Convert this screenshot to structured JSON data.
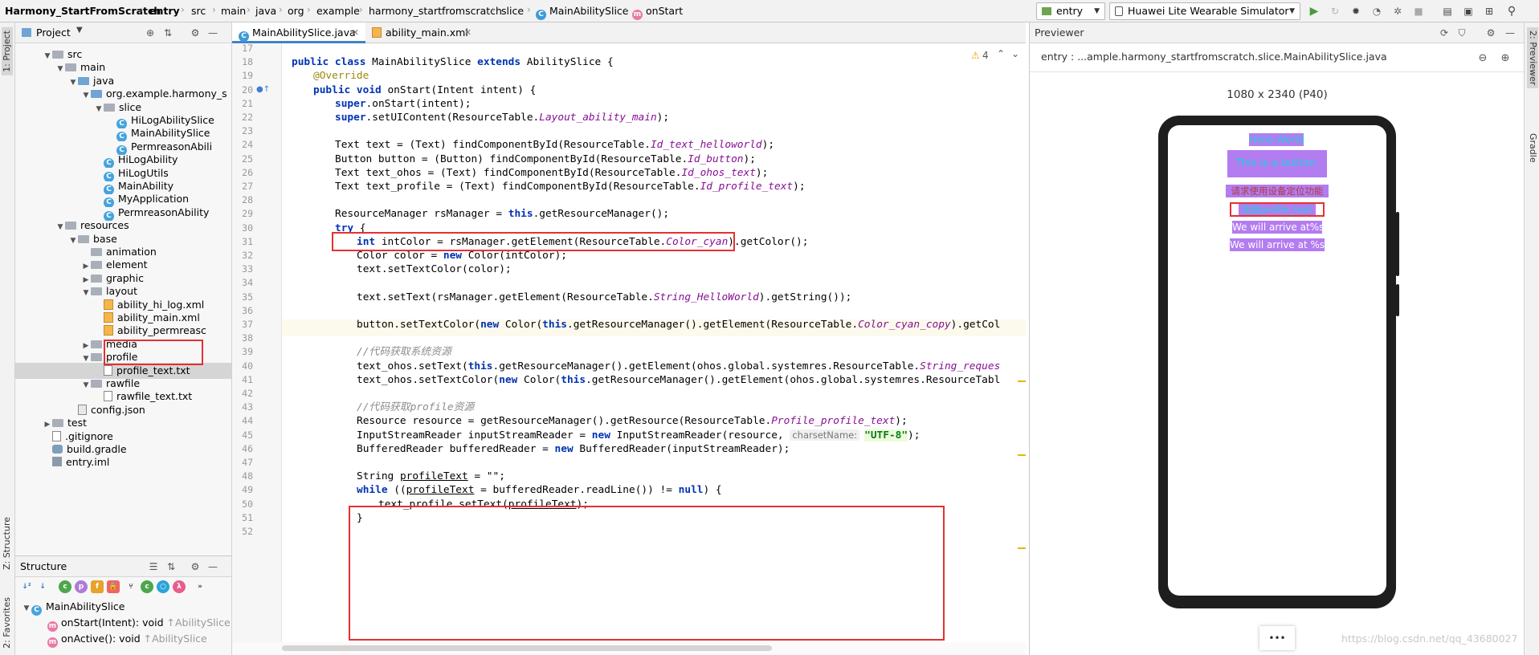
{
  "navbar": {
    "crumbs": [
      "Harmony_StartFromScratch",
      "entry",
      "src",
      "main",
      "java",
      "org",
      "example",
      "harmony_startfromscratch",
      "slice",
      "MainAbilitySlice",
      "onStart"
    ],
    "run_config": "entry",
    "device": "Huawei Lite Wearable Simulator"
  },
  "left_stripe": {
    "project": "1: Project",
    "structure": "Z: Structure",
    "favorites": "2: Favorites"
  },
  "project_panel": {
    "title": "Project",
    "tree": [
      {
        "label": "src",
        "icon": "folder-icon"
      },
      {
        "label": "main",
        "icon": "folder-icon"
      },
      {
        "label": "java",
        "icon": "folder-icon"
      },
      {
        "label": "org.example.harmony_s",
        "icon": "folder-icon"
      },
      {
        "label": "slice",
        "icon": "folder-icon"
      },
      {
        "label": "HiLogAbilitySlice",
        "icon": "class-icon"
      },
      {
        "label": "MainAbilitySlice",
        "icon": "class-icon"
      },
      {
        "label": "PermreasonAbili",
        "icon": "class-icon"
      },
      {
        "label": "HiLogAbility",
        "icon": "class-icon"
      },
      {
        "label": "HiLogUtils",
        "icon": "class-icon"
      },
      {
        "label": "MainAbility",
        "icon": "class-icon"
      },
      {
        "label": "MyApplication",
        "icon": "class-icon"
      },
      {
        "label": "PermreasonAbility",
        "icon": "class-icon"
      },
      {
        "label": "resources",
        "icon": "folder-icon"
      },
      {
        "label": "base",
        "icon": "folder-icon"
      },
      {
        "label": "animation",
        "icon": "folder-icon"
      },
      {
        "label": "element",
        "icon": "folder-icon"
      },
      {
        "label": "graphic",
        "icon": "folder-icon"
      },
      {
        "label": "layout",
        "icon": "folder-icon"
      },
      {
        "label": "ability_hi_log.xml",
        "icon": "xml-file-icon"
      },
      {
        "label": "ability_main.xml",
        "icon": "xml-file-icon"
      },
      {
        "label": "ability_permreasc",
        "icon": "xml-file-icon"
      },
      {
        "label": "media",
        "icon": "folder-icon"
      },
      {
        "label": "profile",
        "icon": "folder-icon"
      },
      {
        "label": "profile_text.txt",
        "icon": "text-file-icon"
      },
      {
        "label": "rawfile",
        "icon": "folder-icon"
      },
      {
        "label": "rawfile_text.txt",
        "icon": "text-file-icon"
      },
      {
        "label": "config.json",
        "icon": "json-file-icon"
      },
      {
        "label": "test",
        "icon": "folder-icon"
      },
      {
        "label": ".gitignore",
        "icon": "text-file-icon"
      },
      {
        "label": "build.gradle",
        "icon": "gradle-icon"
      },
      {
        "label": "entry.iml",
        "icon": "iml-file-icon"
      }
    ]
  },
  "structure_panel": {
    "title": "Structure",
    "root": "MainAbilitySlice",
    "members": [
      {
        "name": "onStart(Intent): void",
        "origin": "↑AbilitySlice"
      },
      {
        "name": "onActive(): void",
        "origin": "↑AbilitySlice"
      }
    ]
  },
  "editor": {
    "tabs": [
      "MainAbilitySlice.java",
      "ability_main.xml"
    ],
    "warnings": "4",
    "line_numbers": [
      "17",
      "18",
      "19",
      "20",
      "21",
      "22",
      "23",
      "24",
      "25",
      "26",
      "27",
      "28",
      "29",
      "30",
      "31",
      "32",
      "33",
      "34",
      "35",
      "36",
      "37",
      "38",
      "39",
      "40",
      "41",
      "42",
      "43",
      "44",
      "45",
      "46",
      "47",
      "48",
      "49",
      "50",
      "51",
      "52"
    ],
    "code": {
      "l18_a": "public class ",
      "l18_b": "MainAbilitySlice ",
      "l18_c": "extends ",
      "l18_d": "AbilitySlice {",
      "l19": "@Override",
      "l20_a": "public void ",
      "l20_b": "onStart(Intent intent) {",
      "l21_a": "super",
      "l21_b": ".onStart(intent);",
      "l22_a": "super",
      "l22_b": ".setUIContent(ResourceTable.",
      "l22_c": "Layout_ability_main",
      "l22_d": ");",
      "l24_a": "Text text = (Text) findComponentById(ResourceTable.",
      "l24_b": "Id_text_helloworld",
      "l24_c": ");",
      "l25_a": "Button button = (Button) findComponentById(ResourceTable.",
      "l25_b": "Id_button",
      "l25_c": ");",
      "l26_a": "Text text_ohos = (Text) findComponentById(ResourceTable.",
      "l26_b": "Id_ohos_text",
      "l26_c": ");",
      "l27_a": "Text text_profile = (Text) findComponentById(ResourceTable.",
      "l27_b": "Id_profile_text",
      "l27_c": ");",
      "l29_a": "ResourceManager rsManager = ",
      "l29_b": "this",
      "l29_c": ".getResourceManager();",
      "l30_a": "try",
      "l30_b": " {",
      "l31_a": "int ",
      "l31_b": "intColor = rsManager.getElement(ResourceTable.",
      "l31_c": "Color_cyan",
      "l31_d": ").getColor();",
      "l32_a": "Color color = ",
      "l32_b": "new ",
      "l32_c": "Color(intColor);",
      "l33": "text.setTextColor(color);",
      "l35_a": "text.setText(rsManager.getElement(ResourceTable.",
      "l35_b": "String_HelloWorld",
      "l35_c": ").getString());",
      "l37_a": "button.setTextColor(",
      "l37_b": "new ",
      "l37_c": "Color(",
      "l37_d": "this",
      "l37_e": ".getResourceManager().getElement(ResourceTable.",
      "l37_f": "Color_cyan_copy",
      "l37_g": ").getCol",
      "l39": "//代码获取系统资源",
      "l40_a": "text_ohos.setText(",
      "l40_b": "this",
      "l40_c": ".getResourceManager().getElement(ohos.global.systemres.ResourceTable.",
      "l40_d": "String_reques",
      "l41_a": "text_ohos.setTextColor(",
      "l41_b": "new ",
      "l41_c": "Color(",
      "l41_d": "this",
      "l41_e": ".getResourceManager().getElement(ohos.global.systemres.ResourceTabl",
      "l43": "//代码获取profile资源",
      "l44_a": "Resource resource = getResourceManager().getResource(ResourceTable.",
      "l44_b": "Profile_profile_text",
      "l44_c": ");",
      "l45_a": "InputStreamReader inputStreamReader = ",
      "l45_b": "new ",
      "l45_c": "InputStreamReader(resource, ",
      "l45_hint": "charsetName:",
      "l45_d": "\"UTF-8\"",
      "l45_e": ");",
      "l46_a": "BufferedReader bufferedReader = ",
      "l46_b": "new ",
      "l46_c": "BufferedReader(inputStreamReader);",
      "l48_a": "String ",
      "l48_b": "profileText",
      "l48_c": " = \"\";",
      "l49_a": "while ",
      "l49_b": "((",
      "l49_c": "profileText",
      "l49_d": " = bufferedReader.readLine()) != ",
      "l49_e": "null",
      "l49_f": ") {",
      "l50_a": "text_profile.setText(",
      "l50_b": "profileText",
      "l50_c": ");",
      "l51": "}"
    }
  },
  "previewer": {
    "title": "Previewer",
    "path": "entry : ...ample.harmony_startfromscratch.slice.MainAbilitySlice.java",
    "resolution": "1080 x 2340 (P40)",
    "items": {
      "hello": "Hello World",
      "button": "This is a button.",
      "request": "请求使用设备定位功能",
      "profile": "我是profile_text",
      "arrive1": "We will arrive at%s",
      "arrive2": "We will arrive at %s"
    },
    "more": "•••",
    "watermark": "https://blog.csdn.net/qq_43680027"
  },
  "right_stripe": {
    "previewer": "2: Previewer",
    "gradle": "Gradle"
  },
  "colors": {
    "accent": "#4083c9",
    "highlight_box": "#e53131",
    "preview_purple": "#b37cf0",
    "cyan": "#1fd0e0"
  }
}
